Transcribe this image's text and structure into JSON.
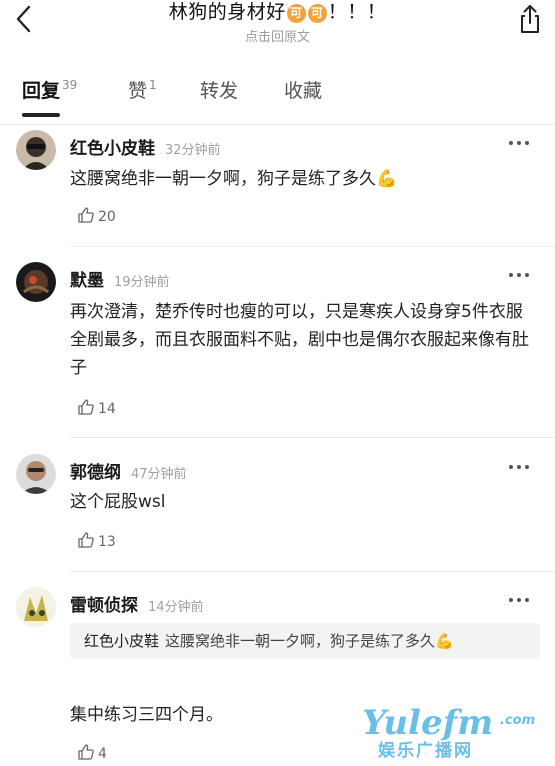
{
  "header": {
    "title_pre": "林狗的身材好",
    "emoji_1": "可",
    "emoji_2": "可",
    "title_post": "！！！",
    "subtitle": "点击回原文"
  },
  "tabs": [
    {
      "label": "回复",
      "count": "39",
      "active": true
    },
    {
      "label": "赞",
      "count": "1",
      "active": false
    },
    {
      "label": "转发",
      "count": "",
      "active": false
    },
    {
      "label": "收藏",
      "count": "",
      "active": false
    }
  ],
  "comments": [
    {
      "name": "红色小皮鞋",
      "time": "32分钟前",
      "text": "这腰窝绝非一朝一夕啊，狗子是练了多久💪",
      "likes": "20"
    },
    {
      "name": "默墨",
      "time": "19分钟前",
      "text": "再次澄清，楚乔传时也瘦的可以，只是寒疾人设身穿5件衣服全剧最多，而且衣服面料不贴，剧中也是偶尔衣服起来像有肚子",
      "likes": "14"
    },
    {
      "name": "郭德纲",
      "time": "47分钟前",
      "text": "这个屁股wsl",
      "likes": "13"
    },
    {
      "name": "雷顿侦探",
      "time": "14分钟前",
      "quote_name": "红色小皮鞋",
      "quote_text": "这腰窝绝非一朝一夕啊，狗子是练了多久💪",
      "text": "集中练习三四个月。",
      "likes": "4"
    }
  ],
  "watermark": {
    "brand": "Yulefm",
    "domain": ".com",
    "cn": "娱乐广播网"
  },
  "colors": {
    "accent_emoji": "#f3a23a",
    "watermark": "#4fb5e6",
    "muted": "#a0a0a0"
  }
}
